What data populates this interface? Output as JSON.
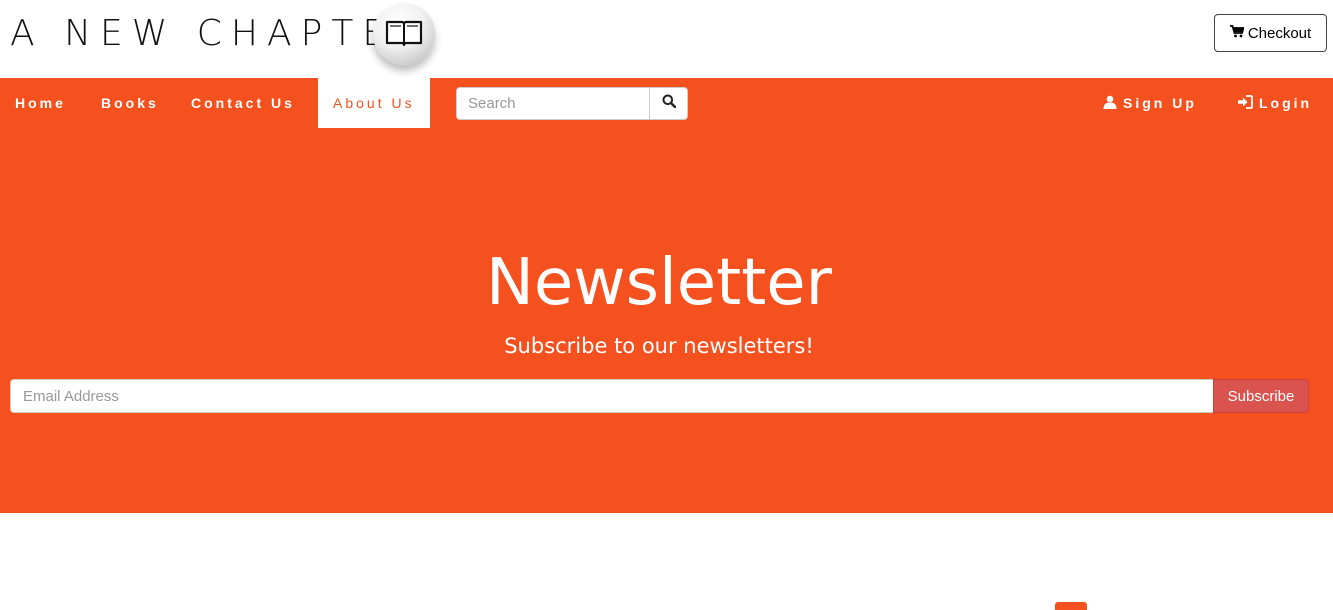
{
  "header": {
    "logo_text": "A NEW CHAPTER",
    "logo_icon": "open-book-icon",
    "checkout_label": "Checkout",
    "checkout_icon": "shopping-cart-icon"
  },
  "nav": {
    "items": [
      {
        "label": "Home"
      },
      {
        "label": "Books"
      },
      {
        "label": "Contact Us"
      },
      {
        "label": "About Us",
        "active": true
      }
    ],
    "search_placeholder": "Search",
    "search_icon": "magnifier-icon",
    "signup_label": "Sign Up",
    "signup_icon": "user-icon",
    "login_label": "Login",
    "login_icon": "log-in-icon"
  },
  "hero": {
    "title": "Newsletter",
    "subtitle": "Subscribe to our newsletters!",
    "email_placeholder": "Email Address",
    "subscribe_label": "Subscribe"
  },
  "colors": {
    "accent": "#f5511f",
    "subscribe": "#d9534f",
    "white": "#ffffff"
  }
}
